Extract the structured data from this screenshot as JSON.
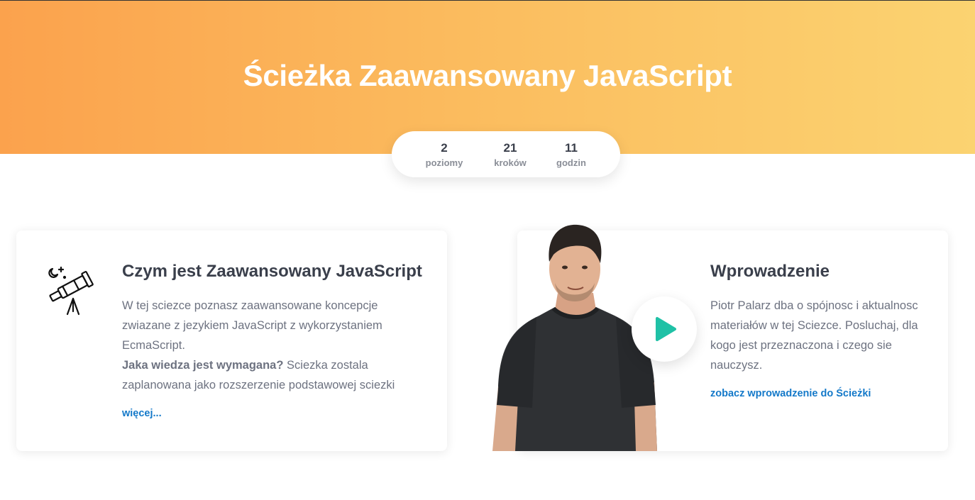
{
  "hero": {
    "title": "Ścieżka Zaawansowany JavaScript"
  },
  "stats": [
    {
      "value": "2",
      "label": "poziomy"
    },
    {
      "value": "21",
      "label": "kroków"
    },
    {
      "value": "11",
      "label": "godzin"
    }
  ],
  "about_card": {
    "icon": "telescope-icon",
    "title": "Czym jest Zaawansowany JavaScript",
    "text": "W tej sciezce poznasz zaawansowane koncepcje zwiazane z jezykiem JavaScript z wykorzystaniem EcmaScript.",
    "question": "Jaka wiedza jest wymagana?",
    "answer": " Sciezka zostala zaplanowana jako rozszerzenie podstawowej sciezki",
    "more_link": "więcej..."
  },
  "intro_card": {
    "title": "Wprowadzenie",
    "text": "Piotr Palarz dba o spójnosc i aktualnosc materiałów w tej Sciezce. Posluchaj, dla kogo jest przeznaczona i czego sie nauczysz.",
    "link": "zobacz wprowadzenie do Ścieżki",
    "play_icon": "play-icon",
    "accent_color": "#1fc1a6"
  },
  "colors": {
    "hero_start": "#fba24d",
    "hero_end": "#fbd371",
    "link": "#1479c9"
  }
}
